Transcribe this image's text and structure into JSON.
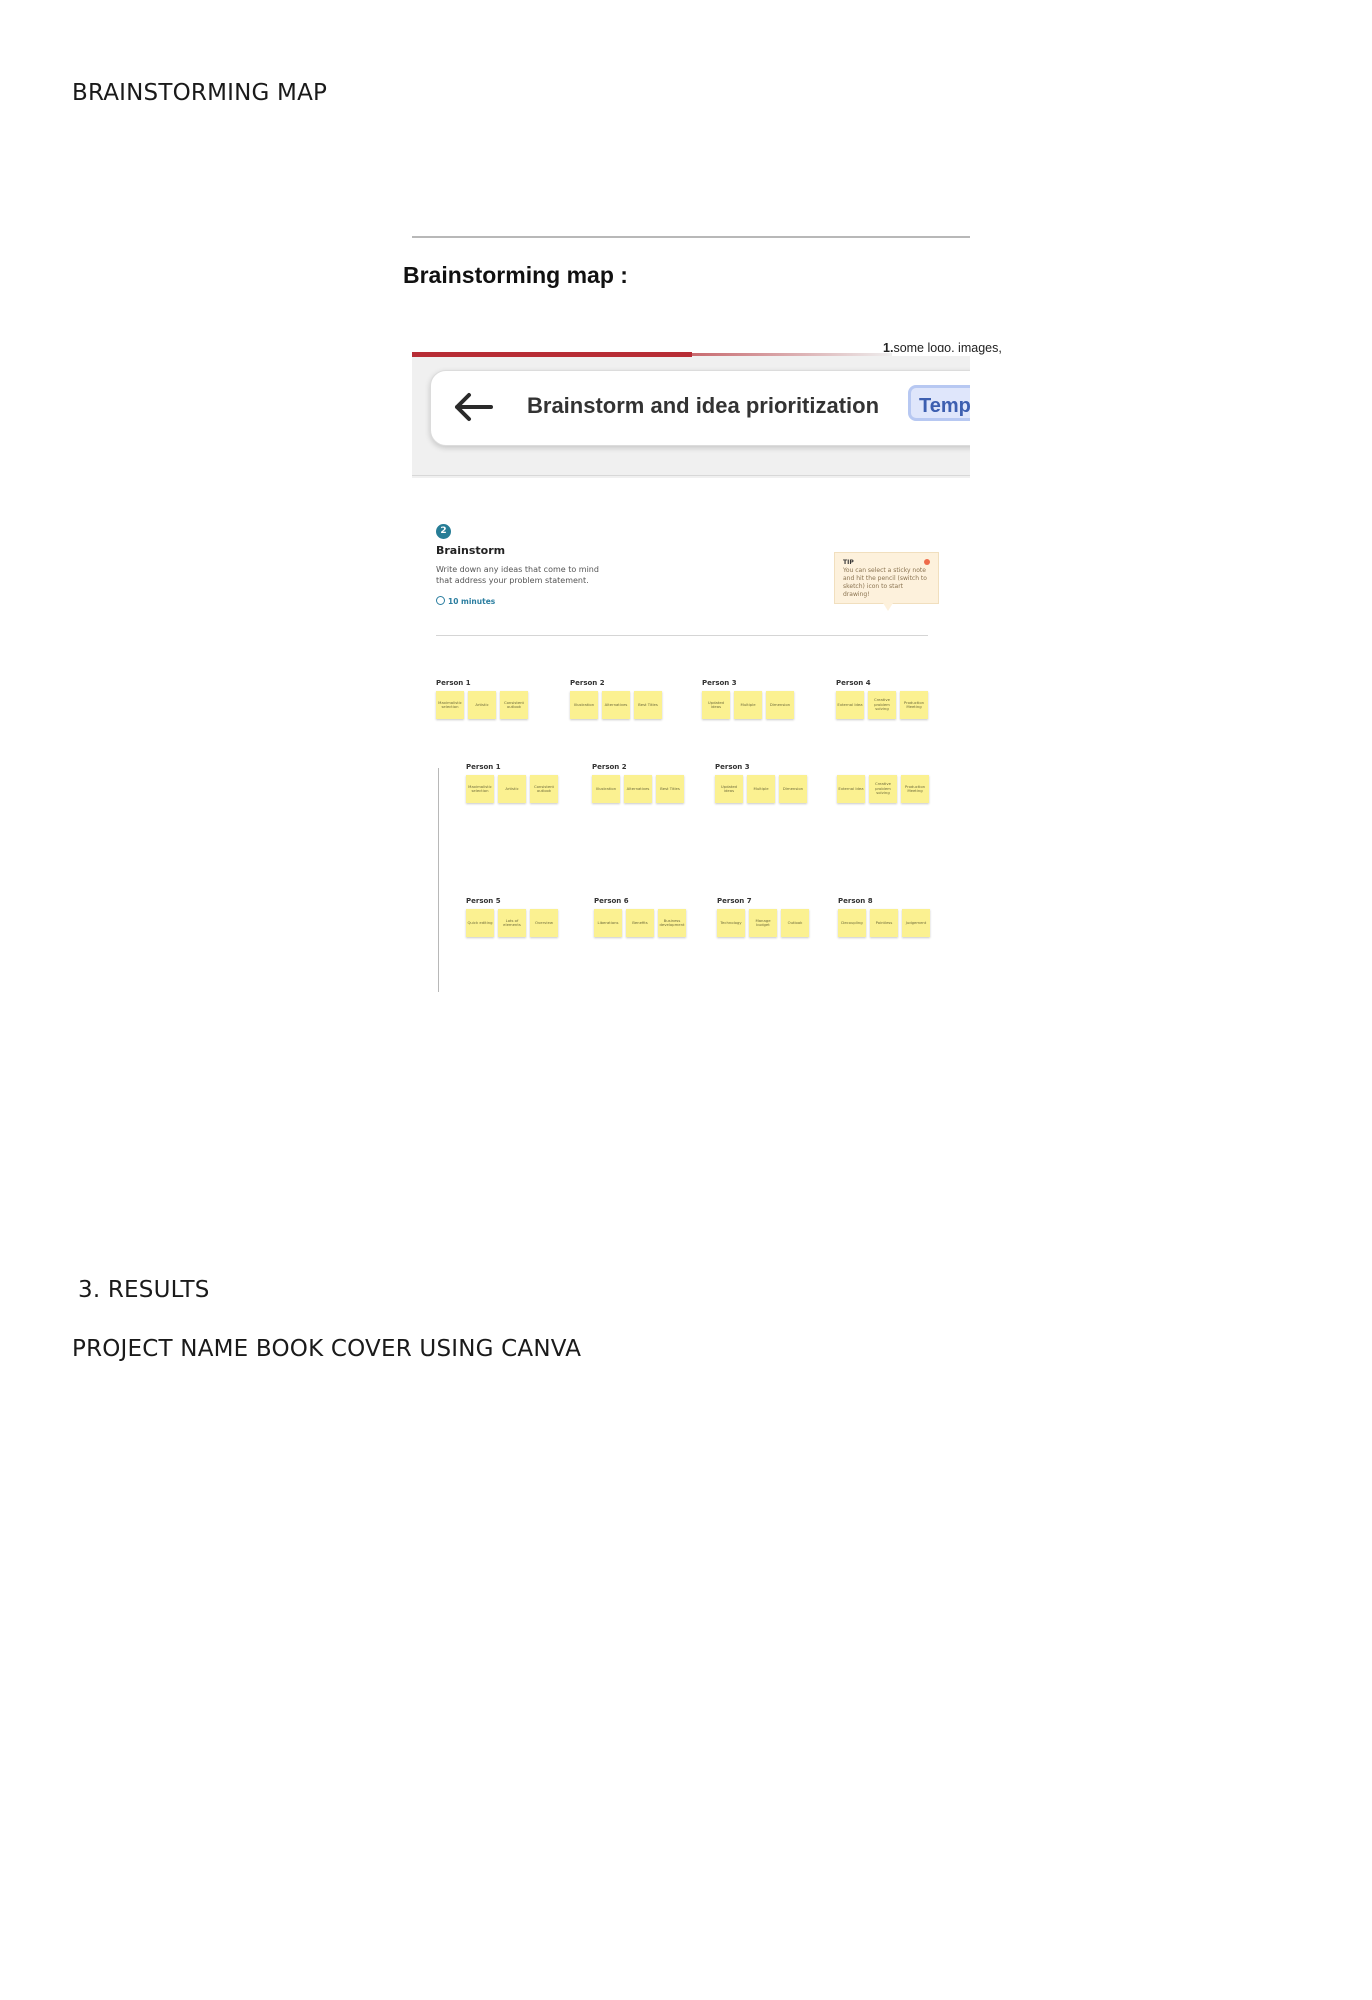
{
  "document": {
    "heading_map": "BRAINSTORMING MAP",
    "heading_results": "3. RESULTS",
    "heading_project": "PROJECT NAME BOOK COVER USING CANVA"
  },
  "figure": {
    "caption": "Brainstorming map :",
    "note_number": "1.",
    "note_text": "some logo, images, costly"
  },
  "mural": {
    "header_title": "Brainstorm and idea prioritization",
    "template_badge": "Temp",
    "step_number": "2",
    "step_title": "Brainstorm",
    "step_description": "Write down any ideas that come to mind that address your problem statement.",
    "step_timer": "10 minutes",
    "tip_label": "TIP",
    "tip_text": "You can select a sticky note and hit the pencil (switch to sketch) icon to start drawing!",
    "row1": [
      {
        "label": "Person 1",
        "notes": [
          "Maximalistic selection",
          "Artistic",
          "Consistent outlook"
        ]
      },
      {
        "label": "Person 2",
        "notes": [
          "Illustration",
          "Alternatives",
          "Best Titles"
        ]
      },
      {
        "label": "Person 3",
        "notes": [
          "Updated ideas",
          "Multiple",
          "Dimension"
        ]
      },
      {
        "label": "Person 4",
        "notes": [
          "External Idea",
          "Creative problem solving",
          "Production Meeting"
        ]
      }
    ],
    "row2": [
      {
        "label": "Person 1",
        "notes": [
          "Maximalistic selection",
          "Artistic",
          "Consistent outlook"
        ]
      },
      {
        "label": "Person 2",
        "notes": [
          "Illustration",
          "Alternatives",
          "Best Titles"
        ]
      },
      {
        "label": "Person 3",
        "notes": [
          "Updated ideas",
          "Multiple",
          "Dimension"
        ]
      },
      {
        "label": "",
        "notes": [
          "External Idea",
          "Creative problem solving",
          "Production Meeting"
        ]
      }
    ],
    "row3": [
      {
        "label": "Person 5",
        "notes": [
          "Quick editing",
          "Lots of elements",
          "Overview"
        ]
      },
      {
        "label": "Person 6",
        "notes": [
          "Liberations",
          "Benefits",
          "Business development"
        ]
      },
      {
        "label": "Person 7",
        "notes": [
          "Technology",
          "Manage budget",
          "Outlook"
        ]
      },
      {
        "label": "Person 8",
        "notes": [
          "Decoupling",
          "Pointless",
          "Judgement"
        ]
      }
    ]
  }
}
